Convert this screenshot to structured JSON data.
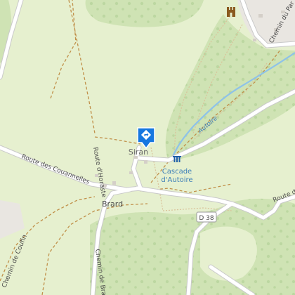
{
  "colors": {
    "meadow": "#e6f0cf",
    "forest": "#cfe3b4",
    "tree_dot": "#bcd7a1",
    "road": "#ffffff",
    "road_edge": "#c9c9c9",
    "track": "#c0904a",
    "trail": "#d9c29a",
    "river": "#8ec2e8",
    "urban": "#e9e6e1",
    "poi_blue": "#1677e0",
    "label": "#4b4b4b",
    "water_label": "#3e7fb8"
  },
  "labels": {
    "siran": "Siran",
    "brard": "Brard",
    "cascade_line1": "Cascade",
    "cascade_line2": "d'Autoire",
    "autoire_stream": "Autoire",
    "road_couannelles": "Route des Couannelles",
    "chemin_horaste": "Route d'Horaste",
    "chemin_brard": "Chemin de Brard",
    "chemin_coufin": "Chemin de Coufin",
    "route_right": "Route de",
    "chemin_top_right": "Chemin du Par",
    "d38": "D 38"
  },
  "icons": {
    "selected_poi": "diamond-turn-sign-icon",
    "waterfall": "waterfall-icon",
    "castle": "castle-icon"
  }
}
